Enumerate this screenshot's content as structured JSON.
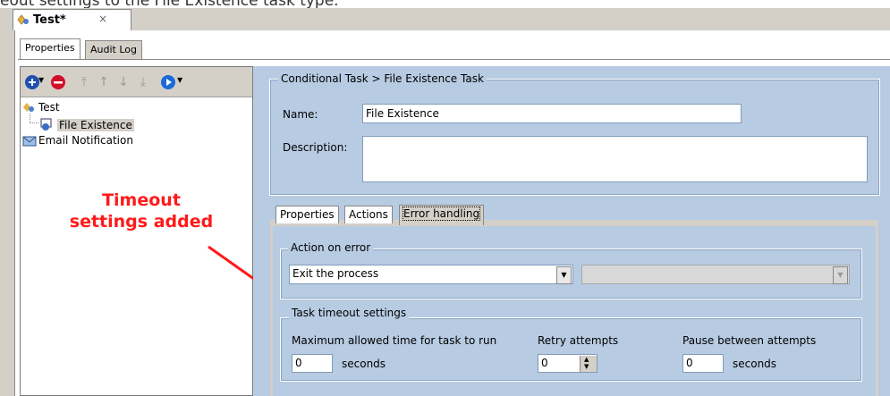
{
  "caption": "eout settings to the File Existence task type.",
  "document_tab": {
    "title": "Test*",
    "close": "×"
  },
  "property_tabs": [
    {
      "label": "Properties",
      "selected": true
    },
    {
      "label": "Audit Log",
      "selected": false
    }
  ],
  "toolbar": {
    "icons": [
      "add-icon",
      "remove-icon",
      "move-top-icon",
      "move-up-icon",
      "move-down-icon",
      "move-bottom-icon",
      "run-icon"
    ]
  },
  "tree": {
    "root": "Test",
    "child": "File Existence",
    "sibling": "Email Notification"
  },
  "breadcrumb": "Conditional Task > File Existence Task",
  "form": {
    "name_label": "Name:",
    "name_value": "File Existence",
    "description_label": "Description:",
    "description_value": ""
  },
  "inner_tabs": [
    {
      "label": "Properties",
      "selected": false
    },
    {
      "label": "Actions",
      "selected": false
    },
    {
      "label": "Error handling",
      "selected": true
    }
  ],
  "action_on_error": {
    "title": "Action on error",
    "selected": "Exit the process",
    "secondary_selected": ""
  },
  "timeout": {
    "title": "Task timeout settings",
    "max_time_label": "Maximum allowed time for task to run",
    "max_time_value": "0",
    "max_time_unit": "seconds",
    "retry_label": "Retry attempts",
    "retry_value": "0",
    "pause_label": "Pause between attempts",
    "pause_value": "0",
    "pause_unit": "seconds"
  },
  "annotation": {
    "line1": "Timeout",
    "line2": "settings added",
    "color": "#ff1a1a"
  },
  "colors": {
    "panel_blue": "#b7cbe2",
    "chrome_gray": "#d4d0c8"
  }
}
